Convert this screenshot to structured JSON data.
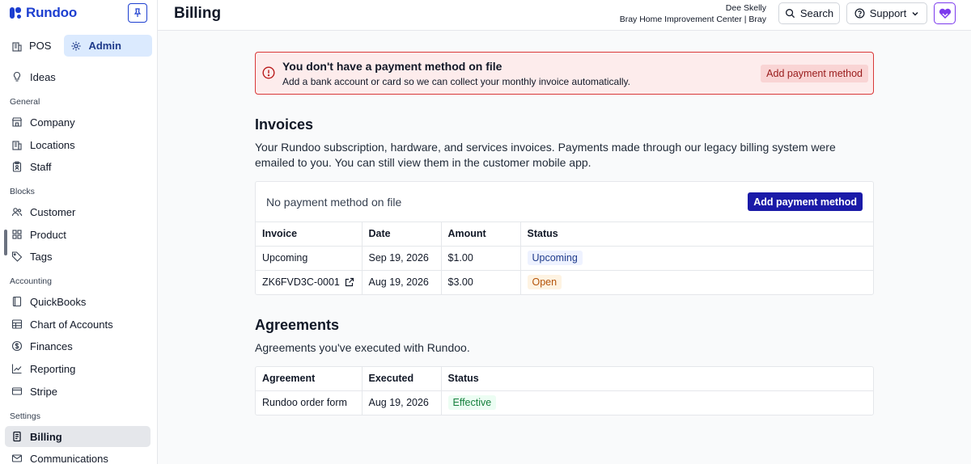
{
  "app": {
    "name": "Rundoo",
    "brand_color": "#1d3fd0"
  },
  "sidebar": {
    "top": [
      {
        "label": "POS",
        "icon": "building-icon"
      },
      {
        "label": "Admin",
        "icon": "gear-icon",
        "active": true
      }
    ],
    "ideas": {
      "label": "Ideas",
      "icon": "lightbulb-icon"
    },
    "sections": {
      "general": "General",
      "blocks": "Blocks",
      "accounting": "Accounting",
      "settings": "Settings"
    },
    "items": {
      "company": "Company",
      "locations": "Locations",
      "staff": "Staff",
      "customer": "Customer",
      "product": "Product",
      "tags": "Tags",
      "quickbooks": "QuickBooks",
      "chart_of_accounts": "Chart of Accounts",
      "finances": "Finances",
      "reporting": "Reporting",
      "stripe": "Stripe",
      "billing": "Billing",
      "communications": "Communications"
    }
  },
  "header": {
    "title": "Billing",
    "user_name": "Dee Skelly",
    "user_org": "Bray Home Improvement Center | Bray",
    "search_label": "Search",
    "support_label": "Support"
  },
  "alert": {
    "title": "You don't have a payment method on file",
    "description": "Add a bank account or card so we can collect your monthly invoice automatically.",
    "button": "Add payment method",
    "color": "#d93838"
  },
  "invoices": {
    "heading": "Invoices",
    "description": "Your Rundoo subscription, hardware, and services invoices. Payments made through our legacy billing system were emailed to you. You can still view them in the customer mobile app.",
    "card_status": "No payment method on file",
    "add_button": "Add payment method",
    "columns": [
      "Invoice",
      "Date",
      "Amount",
      "Status"
    ],
    "rows": [
      {
        "invoice": "Upcoming",
        "date": "Sep 19, 2026",
        "amount": "$1.00",
        "status": "Upcoming"
      },
      {
        "invoice": "ZK6FVD3C-0001",
        "date": "Aug 19, 2026",
        "amount": "$3.00",
        "status": "Open"
      }
    ]
  },
  "agreements": {
    "heading": "Agreements",
    "description": "Agreements you've executed with Rundoo.",
    "columns": [
      "Agreement",
      "Executed",
      "Status"
    ],
    "rows": [
      {
        "agreement": "Rundoo order form",
        "executed": "Aug 19, 2026",
        "status": "Effective"
      }
    ]
  }
}
